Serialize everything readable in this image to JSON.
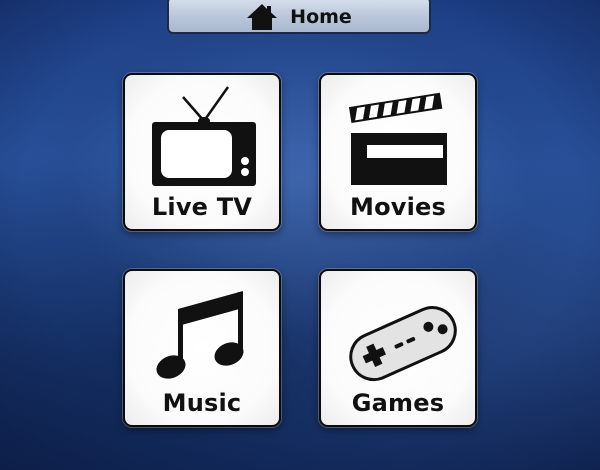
{
  "header": {
    "home_label": "Home",
    "home_icon": "house-icon"
  },
  "tiles": [
    {
      "label": "Live TV",
      "icon": "television-icon"
    },
    {
      "label": "Movies",
      "icon": "clapperboard-icon"
    },
    {
      "label": "Music",
      "icon": "music-note-icon"
    },
    {
      "label": "Games",
      "icon": "gamepad-icon"
    }
  ],
  "colors": {
    "background": "#24498f",
    "tile_background": "#ffffff",
    "tile_border": "#0b0b0b",
    "home_bar": "#c2cee0"
  }
}
